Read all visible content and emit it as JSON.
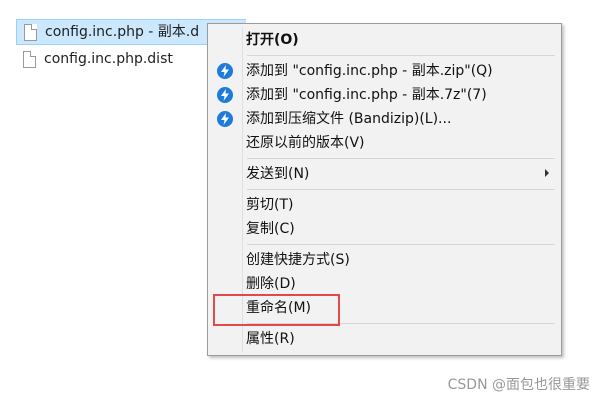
{
  "files": [
    {
      "name": "config.inc.php - 副本.d",
      "selected": true
    },
    {
      "name": "config.inc.php.dist",
      "selected": false
    }
  ],
  "context_menu": {
    "items": [
      {
        "label": "打开(O)",
        "icon": "",
        "bold": true
      },
      {
        "label": "添加到 \"config.inc.php - 副本.zip\"(Q)",
        "icon": "bandizip-icon"
      },
      {
        "label": "添加到 \"config.inc.php - 副本.7z\"(7)",
        "icon": "bandizip-icon"
      },
      {
        "label": "添加到压缩文件 (Bandizip)(L)...",
        "icon": "bandizip-icon"
      },
      {
        "label": "还原以前的版本(V)",
        "icon": ""
      },
      {
        "label": "发送到(N)",
        "icon": "",
        "submenu": true
      },
      {
        "label": "剪切(T)",
        "icon": ""
      },
      {
        "label": "复制(C)",
        "icon": ""
      },
      {
        "label": "创建快捷方式(S)",
        "icon": ""
      },
      {
        "label": "删除(D)",
        "icon": ""
      },
      {
        "label": "重命名(M)",
        "icon": ""
      },
      {
        "label": "属性(R)",
        "icon": ""
      }
    ]
  },
  "watermark": "CSDN @面包也很重要",
  "colors": {
    "selection_bg": "#cce8ff",
    "menu_bg": "#f2f2f2",
    "highlight_box": "#e14a4a",
    "icon_blue": "#1e7bdb"
  }
}
